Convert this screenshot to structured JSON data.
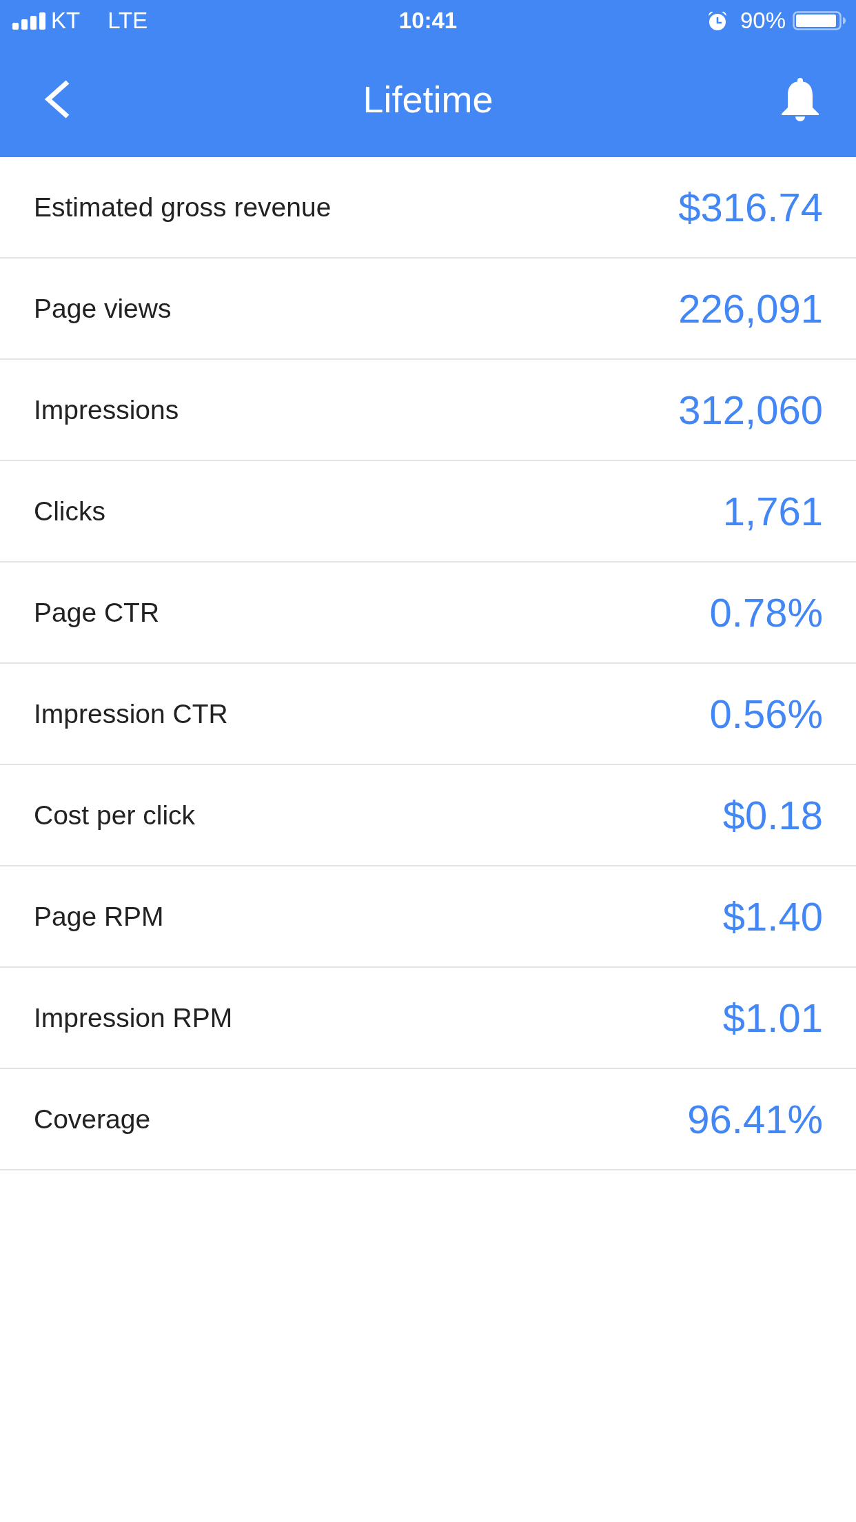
{
  "status_bar": {
    "carrier": "KT",
    "network": "LTE",
    "time": "10:41",
    "battery": "90%"
  },
  "header": {
    "title": "Lifetime"
  },
  "metrics": [
    {
      "label": "Estimated gross revenue",
      "value": "$316.74"
    },
    {
      "label": "Page views",
      "value": "226,091"
    },
    {
      "label": "Impressions",
      "value": "312,060"
    },
    {
      "label": "Clicks",
      "value": "1,761"
    },
    {
      "label": "Page CTR",
      "value": "0.78%"
    },
    {
      "label": "Impression CTR",
      "value": "0.56%"
    },
    {
      "label": "Cost per click",
      "value": "$0.18"
    },
    {
      "label": "Page RPM",
      "value": "$1.40"
    },
    {
      "label": "Impression RPM",
      "value": "$1.01"
    },
    {
      "label": "Coverage",
      "value": "96.41%"
    }
  ]
}
